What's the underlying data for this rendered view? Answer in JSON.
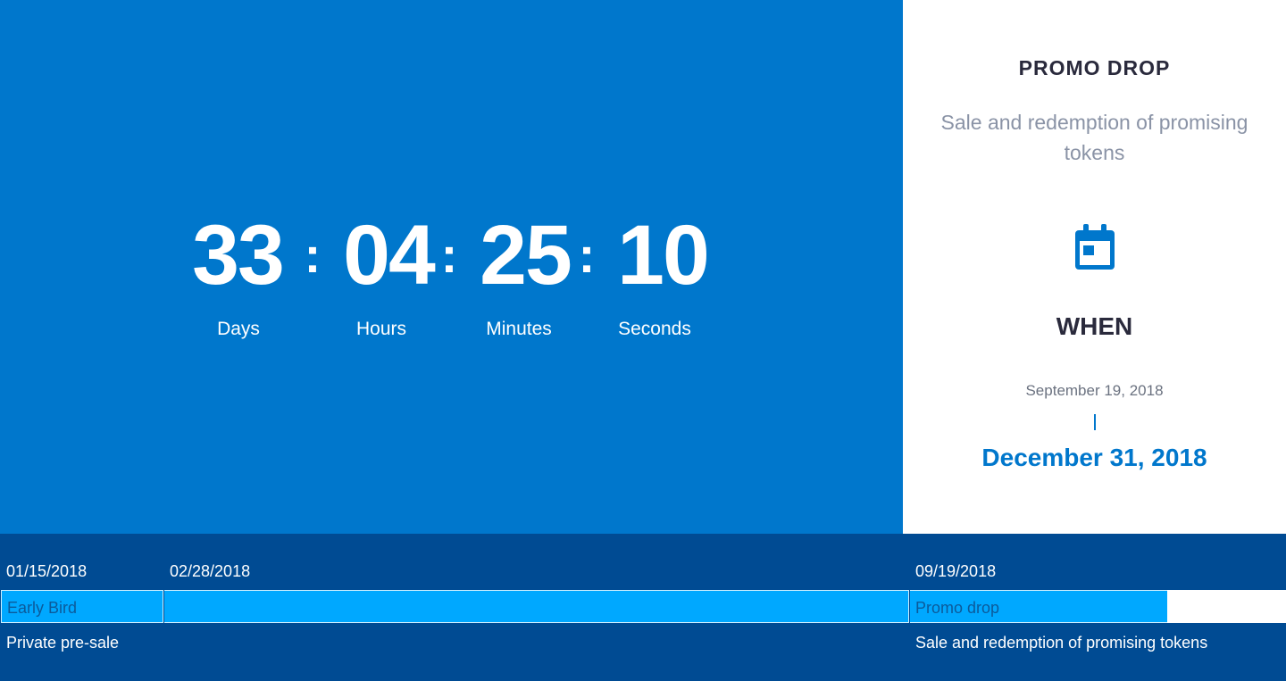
{
  "countdown": {
    "days": "33",
    "hours": "04",
    "minutes": "25",
    "seconds": "10",
    "separator": ":",
    "labels": {
      "days": "Days",
      "hours": "Hours",
      "minutes": "Minutes",
      "seconds": "Seconds"
    }
  },
  "info": {
    "title": "PROMO DROP",
    "subtitle": "Sale and redemption of promising tokens",
    "icon": "calendar-icon",
    "when_title": "WHEN",
    "start_date": "September 19, 2018",
    "end_date": "December 31, 2018"
  },
  "timeline": {
    "stages": [
      {
        "date": "01/15/2018",
        "label": "Early Bird",
        "description": "Private pre-sale"
      },
      {
        "date": "02/28/2018",
        "label": "",
        "description": ""
      },
      {
        "date": "09/19/2018",
        "label": "Promo drop",
        "description": "Sale and redemption of promising tokens"
      }
    ]
  },
  "colors": {
    "primary_blue": "#0077cc",
    "dark_blue": "#004b93",
    "bar_blue": "#00a8ff",
    "title_dark": "#2a2a3c",
    "subtitle_gray": "#8a93a6"
  }
}
